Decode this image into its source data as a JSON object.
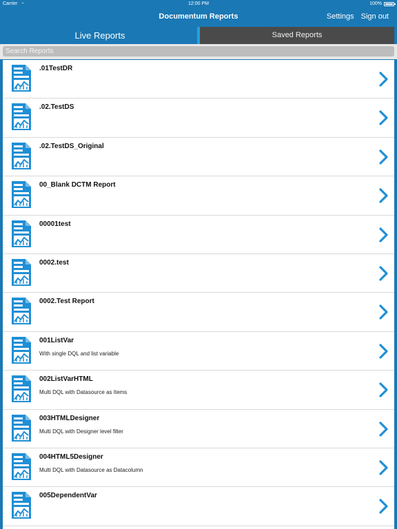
{
  "status": {
    "carrier": "Carrier",
    "wifi_icon": "wifi-icon",
    "time": "12:00 PM",
    "battery": "100%"
  },
  "nav": {
    "title": "Documentum Reports",
    "settings": "Settings",
    "signout": "Sign out"
  },
  "tabs": [
    {
      "label": "Live Reports",
      "active": true
    },
    {
      "label": "Saved Reports",
      "active": false
    }
  ],
  "search": {
    "placeholder": "Search Reports",
    "value": ""
  },
  "colors": {
    "accent": "#1a78b4",
    "icon_blue": "#1f8fd6",
    "tab_inactive": "#4a4a4a"
  },
  "icons": {
    "report": "report-chart-icon",
    "chevron": "chevron-right-icon"
  },
  "reports": [
    {
      "title": ".01TestDR",
      "subtitle": ""
    },
    {
      "title": ".02.TestDS",
      "subtitle": ""
    },
    {
      "title": ".02.TestDS_Original",
      "subtitle": ""
    },
    {
      "title": "00_Blank DCTM Report",
      "subtitle": ""
    },
    {
      "title": "00001test",
      "subtitle": ""
    },
    {
      "title": "0002.test",
      "subtitle": ""
    },
    {
      "title": "0002.Test Report",
      "subtitle": ""
    },
    {
      "title": "001ListVar",
      "subtitle": "With single DQL and list variable"
    },
    {
      "title": "002ListVarHTML",
      "subtitle": "Multi DQL with Datasource as Items"
    },
    {
      "title": "003HTMLDesigner",
      "subtitle": "Multi DQL with Designer level filter"
    },
    {
      "title": "004HTML5Designer",
      "subtitle": "Multi DQL with Datasource as Datacolumn"
    },
    {
      "title": "005DependentVar",
      "subtitle": ""
    }
  ]
}
